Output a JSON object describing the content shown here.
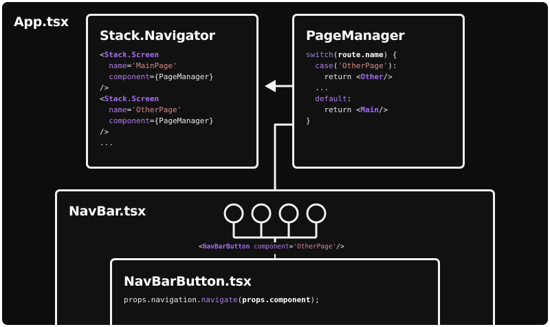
{
  "app": {
    "title": "App.tsx"
  },
  "stack": {
    "title": "Stack.Navigator",
    "lines": [
      [
        {
          "t": "<",
          "c": ""
        },
        {
          "t": "Stack.Screen",
          "c": "comp"
        }
      ],
      [
        {
          "t": "  ",
          "c": ""
        },
        {
          "t": "name",
          "c": "kw"
        },
        {
          "t": "=",
          "c": ""
        },
        {
          "t": "'MainPage'",
          "c": "str"
        }
      ],
      [
        {
          "t": "  ",
          "c": ""
        },
        {
          "t": "component",
          "c": "kw"
        },
        {
          "t": "={PageManager}",
          "c": ""
        }
      ],
      [
        {
          "t": "/>",
          "c": ""
        }
      ],
      [
        {
          "t": "<",
          "c": ""
        },
        {
          "t": "Stack.Screen",
          "c": "comp"
        }
      ],
      [
        {
          "t": "  ",
          "c": ""
        },
        {
          "t": "name",
          "c": "kw"
        },
        {
          "t": "=",
          "c": ""
        },
        {
          "t": "'OtherPage'",
          "c": "str"
        }
      ],
      [
        {
          "t": "  ",
          "c": ""
        },
        {
          "t": "component",
          "c": "kw"
        },
        {
          "t": "={PageManager}",
          "c": ""
        }
      ],
      [
        {
          "t": "/>",
          "c": ""
        }
      ],
      [
        {
          "t": "...",
          "c": ""
        }
      ]
    ]
  },
  "pagemanager": {
    "title": "PageManager",
    "lines": [
      [
        {
          "t": "switch",
          "c": "kw"
        },
        {
          "t": "(",
          "c": ""
        },
        {
          "t": "route.name",
          "c": "bold"
        },
        {
          "t": ") {",
          "c": ""
        }
      ],
      [
        {
          "t": "  ",
          "c": ""
        },
        {
          "t": "case",
          "c": "kw"
        },
        {
          "t": "(",
          "c": ""
        },
        {
          "t": "'OtherPage'",
          "c": "str"
        },
        {
          "t": "):",
          "c": ""
        }
      ],
      [
        {
          "t": "    return <",
          "c": ""
        },
        {
          "t": "Other",
          "c": "comp"
        },
        {
          "t": "/>",
          "c": ""
        }
      ],
      [
        {
          "t": "  ...",
          "c": ""
        }
      ],
      [
        {
          "t": "  ",
          "c": ""
        },
        {
          "t": "default",
          "c": "kw"
        },
        {
          "t": ":",
          "c": ""
        }
      ],
      [
        {
          "t": "    return <",
          "c": ""
        },
        {
          "t": "Main",
          "c": "comp"
        },
        {
          "t": "/>",
          "c": ""
        }
      ],
      [
        {
          "t": "}",
          "c": ""
        }
      ]
    ]
  },
  "navbar": {
    "title": "NavBar.tsx",
    "button_label": [
      {
        "t": "<",
        "c": ""
      },
      {
        "t": "NavBarButton",
        "c": "comp"
      },
      {
        "t": " ",
        "c": ""
      },
      {
        "t": "component",
        "c": "kw"
      },
      {
        "t": "=",
        "c": ""
      },
      {
        "t": "'OtherPage'",
        "c": "str"
      },
      {
        "t": "/>",
        "c": ""
      }
    ],
    "buttons": 4
  },
  "navbarbutton": {
    "title": "NavBarButton.tsx",
    "line": [
      {
        "t": "props.navigation.",
        "c": ""
      },
      {
        "t": "navigate",
        "c": "kw"
      },
      {
        "t": "(",
        "c": ""
      },
      {
        "t": "props.component",
        "c": "bold"
      },
      {
        "t": ");",
        "c": ""
      }
    ]
  },
  "colors": {
    "background": "#0d0d0e",
    "stroke": "#f2f2f2",
    "keyword": "#b07de6",
    "component": "#a66cf5",
    "string": "#d98a8a"
  }
}
